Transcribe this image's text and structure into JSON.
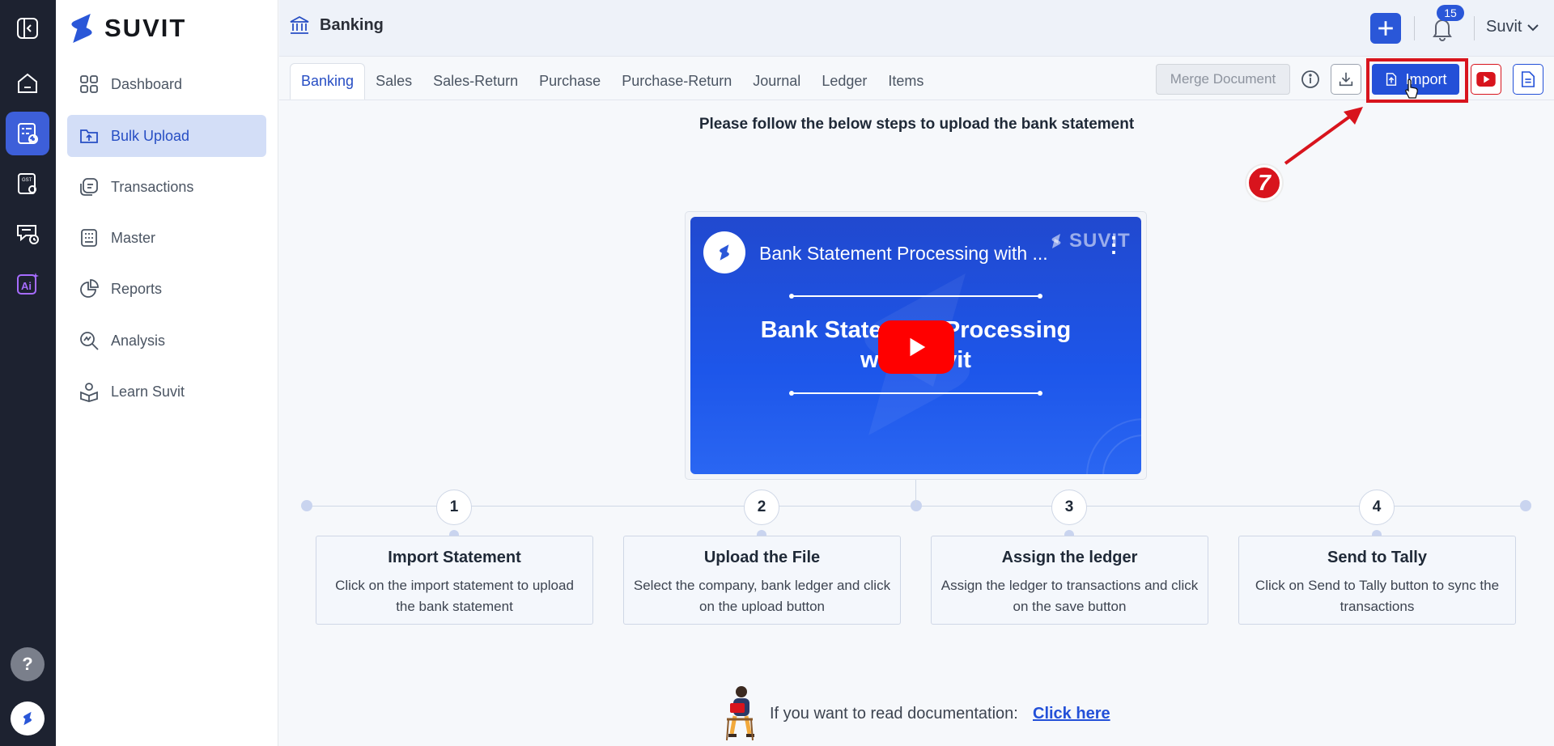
{
  "app": {
    "brand": "SUVIT",
    "colors": {
      "primary": "#2350d8",
      "rail": "#1d2230",
      "highlight": "#d8141d",
      "active_nav_bg": "#d3def7"
    }
  },
  "rail": {
    "items": [
      {
        "icon": "sidebar-collapse-icon"
      },
      {
        "icon": "home-icon"
      },
      {
        "icon": "bulk-upload-icon",
        "active": true
      },
      {
        "icon": "gst-icon"
      },
      {
        "icon": "message-clock-icon"
      },
      {
        "icon": "ai-icon"
      }
    ],
    "help_label": "?"
  },
  "sidebar": {
    "items": [
      {
        "label": "Dashboard",
        "icon": "grid-icon"
      },
      {
        "label": "Bulk Upload",
        "icon": "upload-folder-icon",
        "active": true
      },
      {
        "label": "Transactions",
        "icon": "transactions-icon"
      },
      {
        "label": "Master",
        "icon": "master-icon"
      },
      {
        "label": "Reports",
        "icon": "pie-chart-icon"
      },
      {
        "label": "Analysis",
        "icon": "analysis-icon"
      },
      {
        "label": "Learn Suvit",
        "icon": "learn-icon"
      }
    ]
  },
  "header": {
    "title": "Banking",
    "notification_count": "15",
    "user": "Suvit"
  },
  "tabs": [
    "Banking",
    "Sales",
    "Sales-Return",
    "Purchase",
    "Purchase-Return",
    "Journal",
    "Ledger",
    "Items"
  ],
  "toolbar": {
    "merge_label": "Merge Document",
    "import_label": "Import"
  },
  "annotation": {
    "step_number": "7"
  },
  "main": {
    "instruction": "Please follow the below steps to upload the bank statement",
    "video": {
      "title": "Bank Statement Processing with ...",
      "watermark": "SUVIT",
      "heading_line1": "Bank Statement Processing",
      "heading_line2": "with Suvit"
    },
    "steps": [
      {
        "num": "1",
        "title": "Import Statement",
        "desc": "Click on the import statement to upload the bank statement"
      },
      {
        "num": "2",
        "title": "Upload the File",
        "desc": "Select the company, bank ledger and click on the upload button"
      },
      {
        "num": "3",
        "title": "Assign the ledger",
        "desc": "Assign the ledger to transactions and click on the save button"
      },
      {
        "num": "4",
        "title": "Send to Tally",
        "desc": "Click on Send to Tally button to sync the transactions"
      }
    ],
    "doc_text": "If you want to read documentation:",
    "doc_link": "Click here"
  }
}
